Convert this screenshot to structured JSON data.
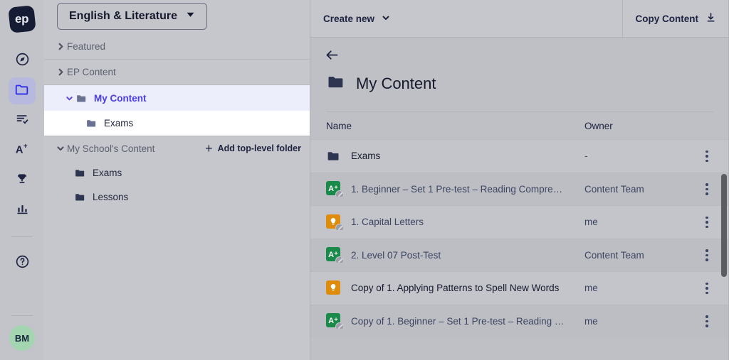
{
  "brand": {
    "logo_text": "ep",
    "logo_name": "ep-logo"
  },
  "subject_selector": {
    "label": "English & Literature",
    "caret": "chevron-down-icon"
  },
  "rail": {
    "items": [
      {
        "name": "explore",
        "icon": "compass-icon",
        "active": false
      },
      {
        "name": "content",
        "icon": "folder-icon",
        "active": true
      },
      {
        "name": "assignments",
        "icon": "checklist-icon",
        "active": false
      },
      {
        "name": "grading",
        "icon": "a-plus-icon",
        "active": false
      },
      {
        "name": "achievements",
        "icon": "trophy-icon",
        "active": false
      },
      {
        "name": "reports",
        "icon": "bar-chart-icon",
        "active": false
      }
    ],
    "help": {
      "name": "help",
      "icon": "help-circle-icon"
    },
    "avatar": {
      "initials": "BM"
    }
  },
  "tree": {
    "sections": [
      {
        "label": "Featured",
        "state": "collapsed",
        "indent": 0
      },
      {
        "label": "EP Content",
        "state": "collapsed",
        "indent": 0
      },
      {
        "label": "My Content",
        "state": "expanded",
        "indent": 1,
        "selected": true
      },
      {
        "label": "Exams",
        "state": "leaf",
        "indent": 2,
        "selected": false
      }
    ],
    "school_section": {
      "label": "My School's Content",
      "state": "expanded",
      "add_folder_label": "Add top-level folder",
      "add_folder_icon": "plus-icon",
      "children": [
        {
          "label": "Exams"
        },
        {
          "label": "Lessons"
        }
      ]
    }
  },
  "toolbar": {
    "create_new_label": "Create new",
    "create_new_caret": "chevron-down-icon",
    "copy_content_label": "Copy Content",
    "copy_content_icon": "download-icon"
  },
  "main": {
    "back_icon": "arrow-left-icon",
    "title": "My Content",
    "title_icon": "folder-icon",
    "columns": {
      "name": "Name",
      "owner": "Owner"
    },
    "rows": [
      {
        "name": "Exams",
        "owner": "-",
        "icon": "folder-icon",
        "icon_kind": "folder",
        "locked": false,
        "link": false
      },
      {
        "name": "1. Beginner – Set 1 Pre-test – Reading Compre…",
        "owner": "Content Team",
        "icon": "assessment-icon",
        "icon_kind": "green",
        "icon_glyph": "A⁺",
        "locked": true,
        "link": true
      },
      {
        "name": "1. Capital Letters",
        "owner": "me",
        "icon": "lesson-icon",
        "icon_kind": "orange",
        "icon_glyph": "ⓧ",
        "locked": true,
        "link": true
      },
      {
        "name": "2. Level 07 Post-Test",
        "owner": "Content Team",
        "icon": "assessment-icon",
        "icon_kind": "green",
        "icon_glyph": "A⁺",
        "locked": true,
        "link": true
      },
      {
        "name": "Copy of 1. Applying Patterns to Spell New Words",
        "owner": "me",
        "icon": "lesson-icon",
        "icon_kind": "orange",
        "icon_glyph": "ⓧ",
        "locked": false,
        "link": false
      },
      {
        "name": "Copy of 1. Beginner – Set 1 Pre-test – Reading …",
        "owner": "me",
        "icon": "assessment-icon",
        "icon_kind": "green",
        "icon_glyph": "A⁺",
        "locked": true,
        "link": true
      }
    ],
    "kebab_name": "row-actions-menu",
    "scrollbar_name": "content-vertical-scrollbar"
  },
  "colors": {
    "accent": "#4a3ce8",
    "rail_active": "#2f2fe8",
    "assessment": "#1a8a4a",
    "lesson": "#dd8c0c",
    "avatar_bg": "#a3d6b0",
    "logo_bg": "#151c33"
  }
}
